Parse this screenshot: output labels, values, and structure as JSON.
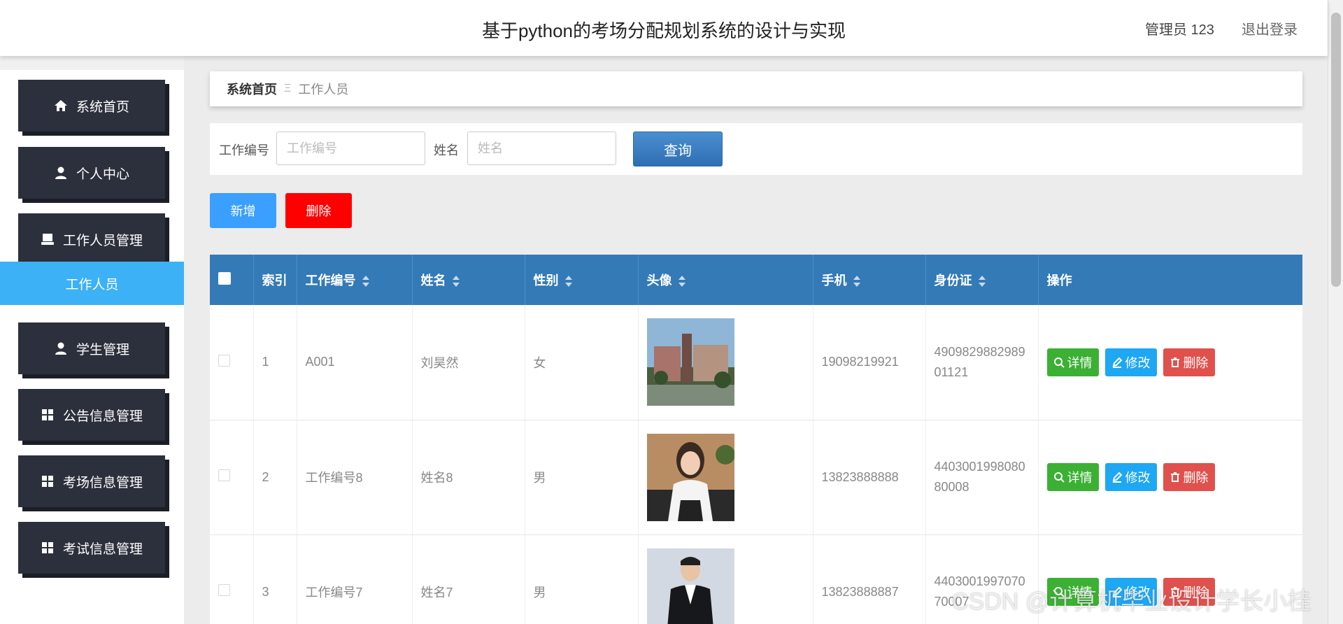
{
  "header": {
    "title": "基于python的考场分配规划系统的设计与实现",
    "user": "管理员 123",
    "logout": "退出登录"
  },
  "sidebar": {
    "items": [
      {
        "label": "系统首页",
        "icon": "home-icon"
      },
      {
        "label": "个人中心",
        "icon": "user-icon"
      },
      {
        "label": "工作人员管理",
        "icon": "staff-icon"
      },
      {
        "label": "学生管理",
        "icon": "user-icon"
      },
      {
        "label": "公告信息管理",
        "icon": "grid-icon"
      },
      {
        "label": "考场信息管理",
        "icon": "grid-icon"
      },
      {
        "label": "考试信息管理",
        "icon": "grid-icon"
      }
    ],
    "submenu_active": "工作人员"
  },
  "breadcrumb": {
    "home": "系统首页",
    "separator": "Ξ",
    "current": "工作人员"
  },
  "search": {
    "field1_label": "工作编号",
    "field1_placeholder": "工作编号",
    "field2_label": "姓名",
    "field2_placeholder": "姓名",
    "button": "查询"
  },
  "actions": {
    "add": "新增",
    "delete": "删除"
  },
  "table": {
    "columns": [
      "索引",
      "工作编号",
      "姓名",
      "性别",
      "头像",
      "手机",
      "身份证",
      "操作"
    ],
    "rows": [
      {
        "index": "1",
        "code": "A001",
        "name": "刘昊然",
        "gender": "女",
        "avatar": "building-photo",
        "phone": "19098219921",
        "id": "490982988298901121"
      },
      {
        "index": "2",
        "code": "工作编号8",
        "name": "姓名8",
        "gender": "男",
        "avatar": "woman-photo",
        "phone": "13823888888",
        "id": "440300199808080008"
      },
      {
        "index": "3",
        "code": "工作编号7",
        "name": "姓名7",
        "gender": "男",
        "avatar": "man-photo",
        "phone": "13823888887",
        "id": "440300199707070007"
      }
    ],
    "ops": {
      "detail": "详情",
      "edit": "修改",
      "delete": "删除"
    }
  },
  "colors": {
    "header_blue": "#337ab7",
    "sidebar_dark": "#2c303c",
    "active_blue": "#3db1f5",
    "green": "#3cb035",
    "red": "#ff0000"
  },
  "watermark": "CSDN @计算机毕业设计学长小桂"
}
